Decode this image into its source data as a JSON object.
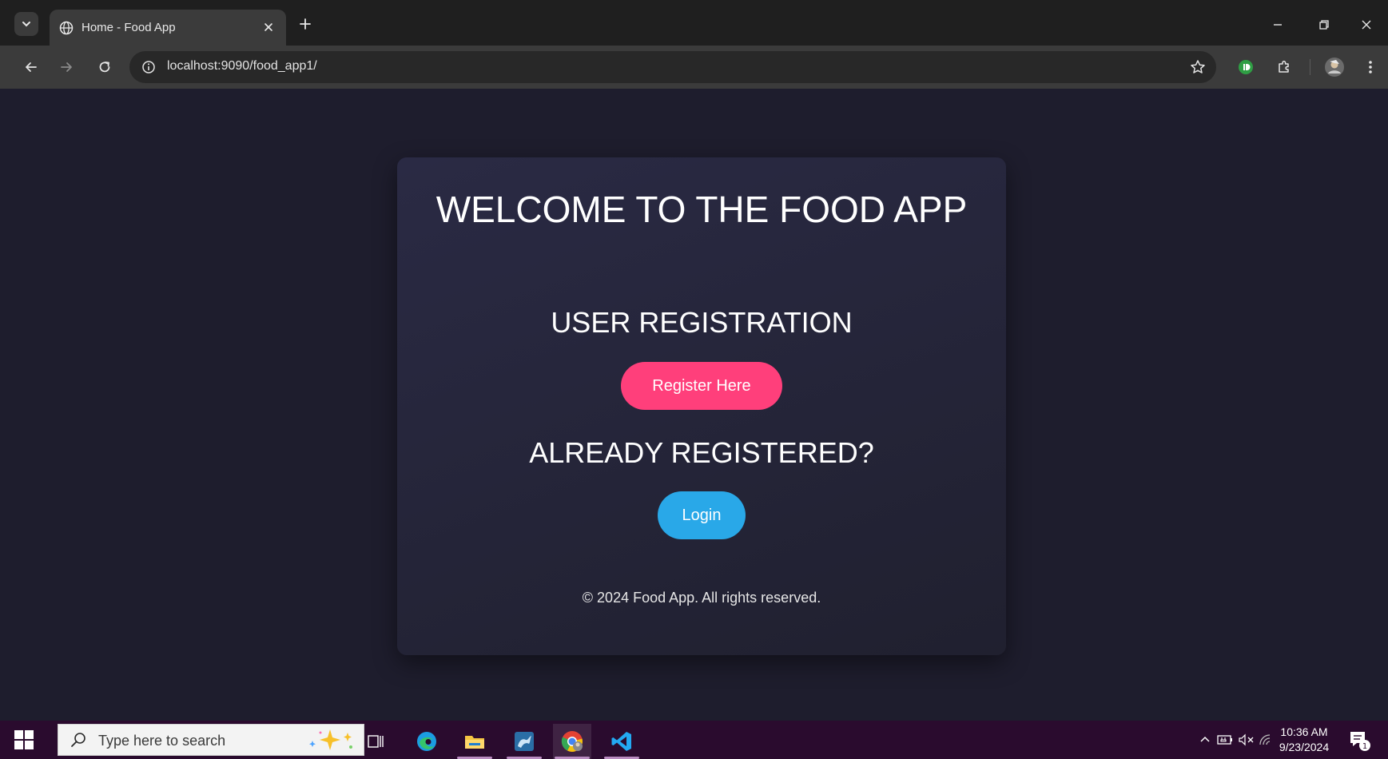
{
  "browser": {
    "tab_title": "Home - Food App",
    "url": "localhost:9090/food_app1/"
  },
  "page": {
    "title": "WELCOME TO THE FOOD APP",
    "registration_heading": "USER REGISTRATION",
    "register_button": "Register Here",
    "login_heading": "ALREADY REGISTERED?",
    "login_button": "Login",
    "copyright": "© 2024 Food App. All rights reserved.",
    "colors": {
      "background": "#1e1d2d",
      "register_button": "#ff3f7b",
      "login_button": "#29a8e8"
    }
  },
  "taskbar": {
    "search_placeholder": "Type here to search",
    "time": "10:36 AM",
    "date": "9/23/2024",
    "notification_count": "1"
  }
}
